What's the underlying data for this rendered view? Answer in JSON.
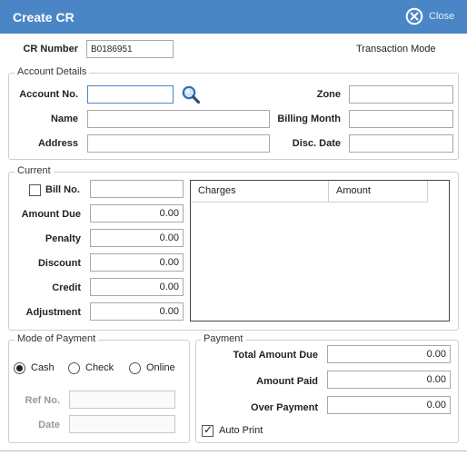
{
  "window": {
    "title": "Create CR",
    "close_label": "Close"
  },
  "header": {
    "cr_number_label": "CR Number",
    "cr_number_value": "B0186951",
    "mode_label": "Transaction Mode"
  },
  "account": {
    "legend": "Account Details",
    "account_no_label": "Account No.",
    "account_no_value": "",
    "name_label": "Name",
    "name_value": "",
    "address_label": "Address",
    "address_value": "",
    "zone_label": "Zone",
    "zone_value": "",
    "billing_month_label": "Billing Month",
    "billing_month_value": "",
    "disc_date_label": "Disc. Date",
    "disc_date_value": ""
  },
  "current": {
    "legend": "Current",
    "bill_no_label": "Bill No.",
    "bill_no_value": "",
    "bill_no_checked": false,
    "amount_due_label": "Amount Due",
    "amount_due_value": "0.00",
    "penalty_label": "Penalty",
    "penalty_value": "0.00",
    "discount_label": "Discount",
    "discount_value": "0.00",
    "credit_label": "Credit",
    "credit_value": "0.00",
    "adjustment_label": "Adjustment",
    "adjustment_value": "0.00",
    "grid_columns": [
      "Charges",
      "Amount"
    ]
  },
  "mode_of_payment": {
    "legend": "Mode of Payment",
    "options": [
      "Cash",
      "Check",
      "Online"
    ],
    "selected": "Cash",
    "ref_no_label": "Ref No.",
    "ref_no_value": "",
    "date_label": "Date",
    "date_value": ""
  },
  "payment": {
    "legend": "Payment",
    "total_amount_due_label": "Total Amount Due",
    "total_amount_due_value": "0.00",
    "amount_paid_label": "Amount Paid",
    "amount_paid_value": "0.00",
    "over_payment_label": "Over Payment",
    "over_payment_value": "0.00",
    "auto_print_label": "Auto Print",
    "auto_print_checked": true
  },
  "colors": {
    "titlebar": "#4a86c5",
    "accent": "#4a86c5",
    "border": "#a9a9a9"
  },
  "icons": {
    "close": "close-circle-icon",
    "search": "magnifier-icon"
  }
}
